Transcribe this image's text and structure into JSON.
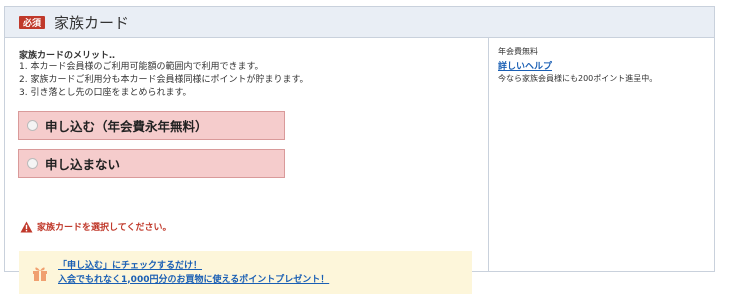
{
  "header": {
    "badge": "必須",
    "title": "家族カード"
  },
  "merits": {
    "title": "家族カードのメリット‥",
    "items": [
      "1. 本カード会員様のご利用可能額の範囲内で利用できます。",
      "2. 家族カードご利用分も本カード会員様同様にポイントが貯まります。",
      "3. 引き落とし先の口座をまとめられます。"
    ]
  },
  "options": [
    {
      "label": "申し込む（年会費永年無料）"
    },
    {
      "label": "申し込まない"
    }
  ],
  "error": {
    "text": "家族カードを選択してください。"
  },
  "promo": {
    "line1": "「申し込む」にチェックするだけ！",
    "line2": "入会でもれなく1,000円分のお買物に使えるポイントプレゼント！"
  },
  "sidebar": {
    "fee": "年会費無料",
    "help_link": "詳しいヘルプ",
    "note": "今なら家族会員様にも200ポイント進呈中。"
  },
  "colors": {
    "badge": "#c0392b",
    "option_bg": "#f5cccc",
    "error": "#c0392b",
    "link": "#1a5fb4",
    "promo_bg": "#fdf6da"
  },
  "icons": [
    "warning-icon",
    "gift-icon",
    "radio-icon"
  ]
}
